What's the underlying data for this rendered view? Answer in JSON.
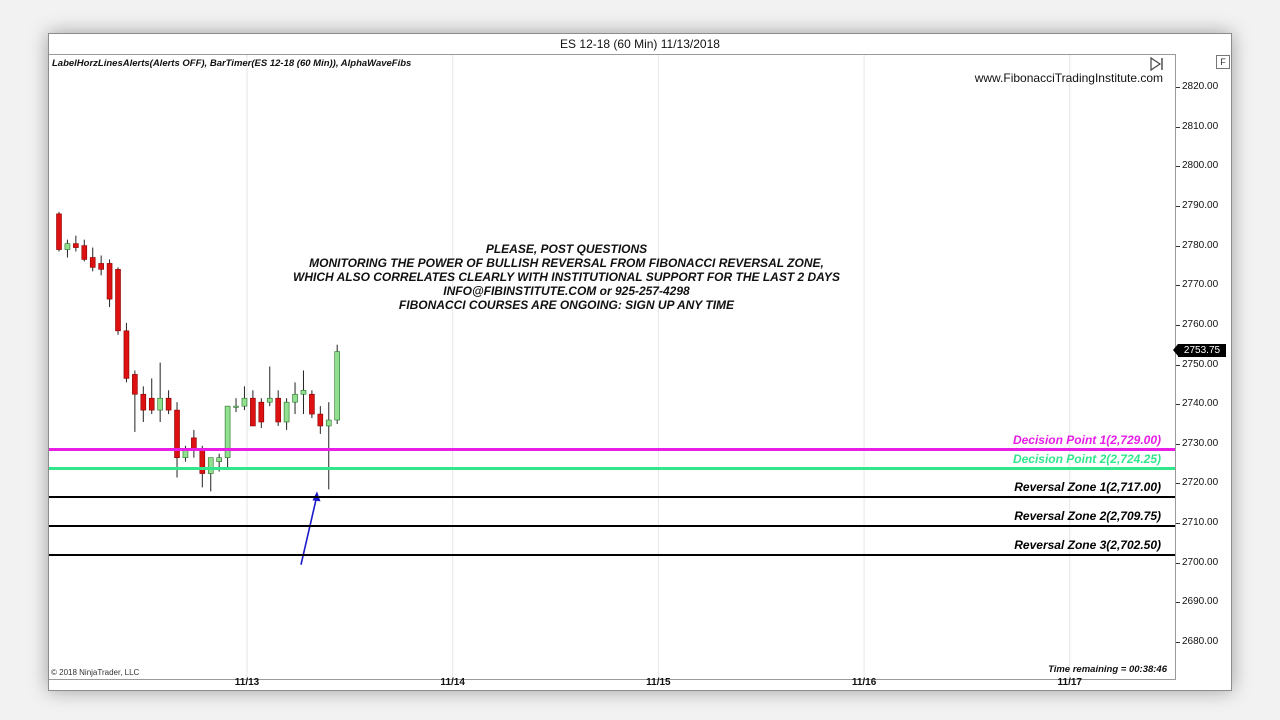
{
  "window": {
    "title": "ES 12-18 (60 Min)  11/13/2018",
    "indicators_label": "LabelHorzLinesAlerts(Alerts OFF), BarTimer(ES 12-18 (60 Min)), AlphaWaveFibs",
    "website": "www.FibonacciTradingInstitute.com",
    "copyright": "© 2018 NinjaTrader, LLC",
    "time_remaining": "Time remaining = 00:38:46",
    "f_button": "F",
    "current_price": "2753.75"
  },
  "annotation": {
    "lines": [
      "PLEASE, POST QUESTIONS",
      "MONITORING THE POWER OF BULLISH REVERSAL FROM FIBONACCI REVERSAL ZONE,",
      "WHICH ALSO CORRELATES CLEARLY WITH INSTITUTIONAL SUPPORT FOR THE LAST 2 DAYS",
      "INFO@FIBINSTITUTE.COM or 925-257-4298",
      "FIBONACCI COURSES ARE ONGOING: SIGN UP ANY TIME"
    ]
  },
  "levels": [
    {
      "label": "Decision Point 1(2,729.00)",
      "value": 2729.0,
      "color": "#e61ee6",
      "thickness": 3
    },
    {
      "label": "Decision Point 2(2,724.25)",
      "value": 2724.25,
      "color": "#32e68c",
      "thickness": 3
    },
    {
      "label": "Reversal Zone 1(2,717.00)",
      "value": 2717.0,
      "color": "#000000",
      "thickness": 2
    },
    {
      "label": "Reversal  Zone 2(2,709.75)",
      "value": 2709.75,
      "color": "#000000",
      "thickness": 2
    },
    {
      "label": "Reversal Zone 3(2,702.50)",
      "value": 2702.5,
      "color": "#000000",
      "thickness": 2
    }
  ],
  "colors": {
    "bull_candle": "#90e090",
    "bear_candle": "#dd1111",
    "arrow": "#1a1acc",
    "grid": "#e6e6e6"
  },
  "chart_data": {
    "type": "candlestick",
    "title": "ES 12-18 (60 Min)  11/13/2018",
    "ylim": [
      2677,
      2830
    ],
    "y_ticks": [
      "2820.00",
      "2810.00",
      "2800.00",
      "2790.00",
      "2780.00",
      "2770.00",
      "2760.00",
      "2750.00",
      "2740.00",
      "2730.00",
      "2720.00",
      "2710.00",
      "2700.00",
      "2690.00",
      "2680.00"
    ],
    "x_ticks": [
      {
        "label": "11/13",
        "bar": 22.3
      },
      {
        "label": "11/14",
        "bar": 46.7
      },
      {
        "label": "11/15",
        "bar": 71.1
      },
      {
        "label": "11/16",
        "bar": 95.5
      },
      {
        "label": "11/17",
        "bar": 119.9
      }
    ],
    "candles": [
      {
        "o": 2788.5,
        "h": 2789.0,
        "l": 2779.0,
        "c": 2779.5
      },
      {
        "o": 2779.5,
        "h": 2782.0,
        "l": 2777.5,
        "c": 2781.0
      },
      {
        "o": 2781.0,
        "h": 2783.0,
        "l": 2779.0,
        "c": 2780.0
      },
      {
        "o": 2780.5,
        "h": 2782.0,
        "l": 2776.5,
        "c": 2777.0
      },
      {
        "o": 2777.5,
        "h": 2780.0,
        "l": 2774.0,
        "c": 2775.0
      },
      {
        "o": 2776.0,
        "h": 2778.0,
        "l": 2773.0,
        "c": 2774.5
      },
      {
        "o": 2776.0,
        "h": 2777.0,
        "l": 2765.0,
        "c": 2767.0
      },
      {
        "o": 2774.5,
        "h": 2775.0,
        "l": 2758.0,
        "c": 2759.0
      },
      {
        "o": 2759.0,
        "h": 2761.0,
        "l": 2746.0,
        "c": 2747.0
      },
      {
        "o": 2748.0,
        "h": 2749.0,
        "l": 2733.5,
        "c": 2743.0
      },
      {
        "o": 2743.0,
        "h": 2745.0,
        "l": 2736.0,
        "c": 2739.0
      },
      {
        "o": 2742.0,
        "h": 2747.0,
        "l": 2738.0,
        "c": 2739.0
      },
      {
        "o": 2739.0,
        "h": 2751.0,
        "l": 2736.0,
        "c": 2742.0
      },
      {
        "o": 2742.0,
        "h": 2744.0,
        "l": 2738.0,
        "c": 2739.0
      },
      {
        "o": 2739.0,
        "h": 2741.0,
        "l": 2722.0,
        "c": 2727.0
      },
      {
        "o": 2727.0,
        "h": 2730.0,
        "l": 2726.0,
        "c": 2729.0
      },
      {
        "o": 2732.0,
        "h": 2734.0,
        "l": 2727.0,
        "c": 2729.0
      },
      {
        "o": 2729.0,
        "h": 2730.0,
        "l": 2719.5,
        "c": 2723.0
      },
      {
        "o": 2723.0,
        "h": 2727.0,
        "l": 2718.5,
        "c": 2727.0
      },
      {
        "o": 2726.0,
        "h": 2728.0,
        "l": 2723.5,
        "c": 2727.0
      },
      {
        "o": 2727.0,
        "h": 2730.0,
        "l": 2724.5,
        "c": 2740.0
      },
      {
        "o": 2740.0,
        "h": 2742.0,
        "l": 2738.5,
        "c": 2740.0
      },
      {
        "o": 2740.0,
        "h": 2745.0,
        "l": 2739.0,
        "c": 2742.0
      },
      {
        "o": 2742.0,
        "h": 2744.0,
        "l": 2737.0,
        "c": 2735.0
      },
      {
        "o": 2741.0,
        "h": 2742.0,
        "l": 2734.5,
        "c": 2736.0
      },
      {
        "o": 2741.0,
        "h": 2750.0,
        "l": 2740.0,
        "c": 2742.0
      },
      {
        "o": 2742.0,
        "h": 2744.0,
        "l": 2735.0,
        "c": 2736.0
      },
      {
        "o": 2736.0,
        "h": 2742.0,
        "l": 2734.0,
        "c": 2741.0
      },
      {
        "o": 2741.0,
        "h": 2746.0,
        "l": 2738.0,
        "c": 2743.0
      },
      {
        "o": 2743.0,
        "h": 2749.0,
        "l": 2738.0,
        "c": 2744.0
      },
      {
        "o": 2743.0,
        "h": 2744.0,
        "l": 2737.0,
        "c": 2738.0
      },
      {
        "o": 2738.0,
        "h": 2740.0,
        "l": 2733.0,
        "c": 2735.0
      },
      {
        "o": 2735.0,
        "h": 2741.0,
        "l": 2719.0,
        "c": 2736.5
      },
      {
        "o": 2736.5,
        "h": 2755.5,
        "l": 2735.5,
        "c": 2753.75
      }
    ]
  }
}
